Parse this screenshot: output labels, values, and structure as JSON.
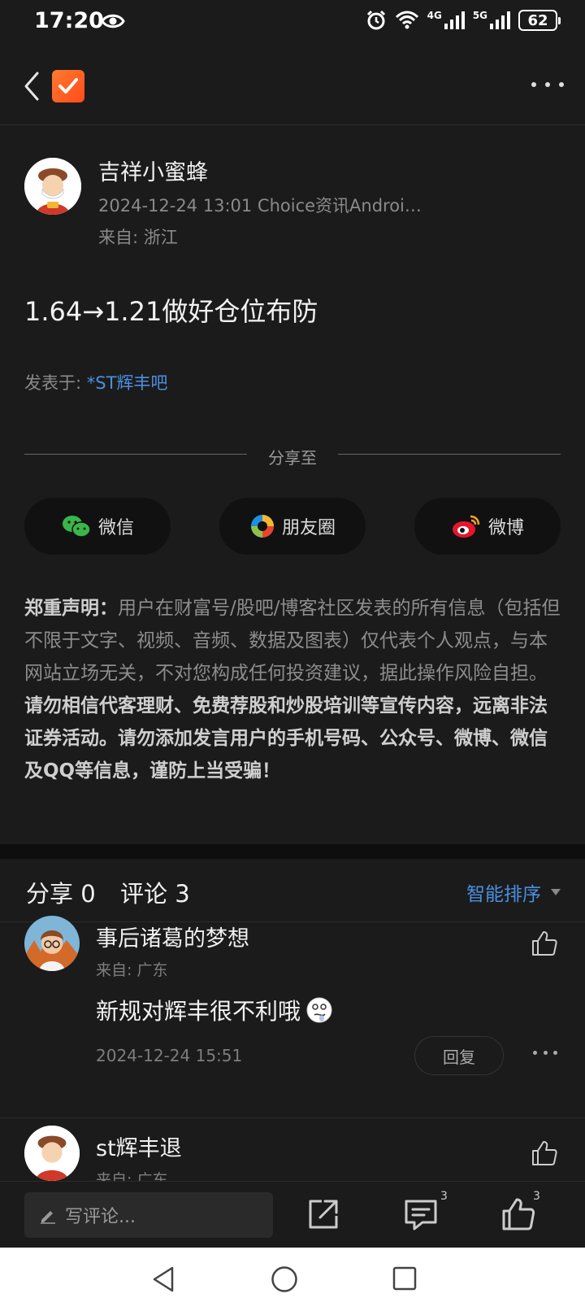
{
  "status_bar": {
    "time": "17:20",
    "net1": "4G",
    "net2": "5G",
    "battery": "62"
  },
  "author": {
    "name": "吉祥小蜜蜂",
    "meta": "2024-12-24 13:01 Choice资讯Androi…",
    "location": "来自: 浙江"
  },
  "post": {
    "title": "1.64→1.21做好仓位布防",
    "posted_in_label": "发表于: ",
    "forum": "*ST辉丰吧"
  },
  "share": {
    "label": "分享至",
    "wechat": "微信",
    "moments": "朋友圈",
    "weibo": "微博"
  },
  "disclaimer": {
    "title": "郑重声明：",
    "normal": "用户在财富号/股吧/博客社区发表的所有信息（包括但不限于文字、视频、音频、数据及图表）仅代表个人观点，与本网站立场无关，不对您构成任何投资建议，据此操作风险自担。",
    "bold": "请勿相信代客理财、免费荐股和炒股培训等宣传内容，远离非法证券活动。请勿添加发言用户的手机号码、公众号、微博、微信及QQ等信息，谨防上当受骗！"
  },
  "stats": {
    "share": "分享 0",
    "comment": "评论 3",
    "sort": "智能排序"
  },
  "comments": [
    {
      "name": "事后诸葛的梦想",
      "location": "来自: 广东",
      "text": "新规对辉丰很不利哦",
      "time": "2024-12-24 15:51",
      "reply": "回复"
    },
    {
      "name": "st辉丰退",
      "location": "来自: 广东"
    }
  ],
  "bottom_bar": {
    "input_placeholder": "写评论...",
    "comment_count": "3",
    "like_count": "3"
  },
  "colors": {
    "background": "#1b1b1b",
    "link": "#4a8fe0",
    "logo": "#ff5a1f"
  }
}
